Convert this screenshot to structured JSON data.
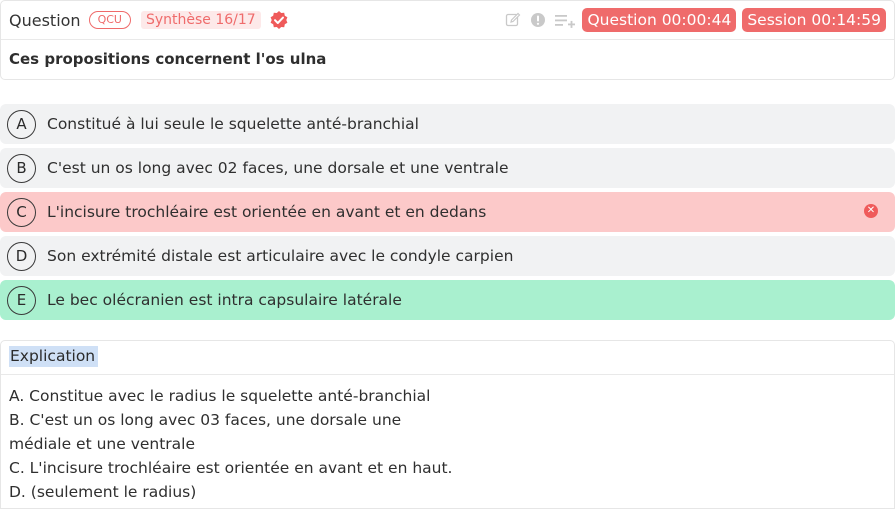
{
  "header": {
    "title": "Question",
    "type_badge": "QCU",
    "synthese_badge": "Synthèse 16/17",
    "question_timer": "Question 00:00:44",
    "session_timer": "Session 00:14:59"
  },
  "question": {
    "text": "Ces propositions concernent l'os ulna"
  },
  "choices": [
    {
      "letter": "A",
      "text": "Constitué à lui seule le squelette anté-branchial",
      "state": "neutral"
    },
    {
      "letter": "B",
      "text": "C'est un os long avec 02 faces, une dorsale et une ventrale",
      "state": "neutral"
    },
    {
      "letter": "C",
      "text": "L'incisure trochléaire est orientée en avant et en dedans",
      "state": "wrong"
    },
    {
      "letter": "D",
      "text": "Son extrémité distale est articulaire avec le condyle carpien",
      "state": "neutral"
    },
    {
      "letter": "E",
      "text": "Le bec olécranien est intra capsulaire latérale",
      "state": "correct"
    }
  ],
  "explanation": {
    "title": "Explication",
    "lines": [
      "A. Constitue avec le radius le squelette anté-branchial",
      "B. C'est un os long avec 03 faces, une dorsale une",
      "médiale et une ventrale",
      "C. L'incisure trochléaire est orientée en avant et en haut.",
      "D. (seulement le radius)"
    ]
  },
  "colors": {
    "accent": "#ef6b6b",
    "wrong_bg": "#fcc9c9",
    "correct_bg": "#a9f0cf",
    "neutral_bg": "#f1f2f3",
    "highlight": "#cfe0f6"
  },
  "icons": [
    "verified-badge-icon",
    "edit-icon",
    "report-icon",
    "add-to-list-icon",
    "close-circle-icon"
  ]
}
